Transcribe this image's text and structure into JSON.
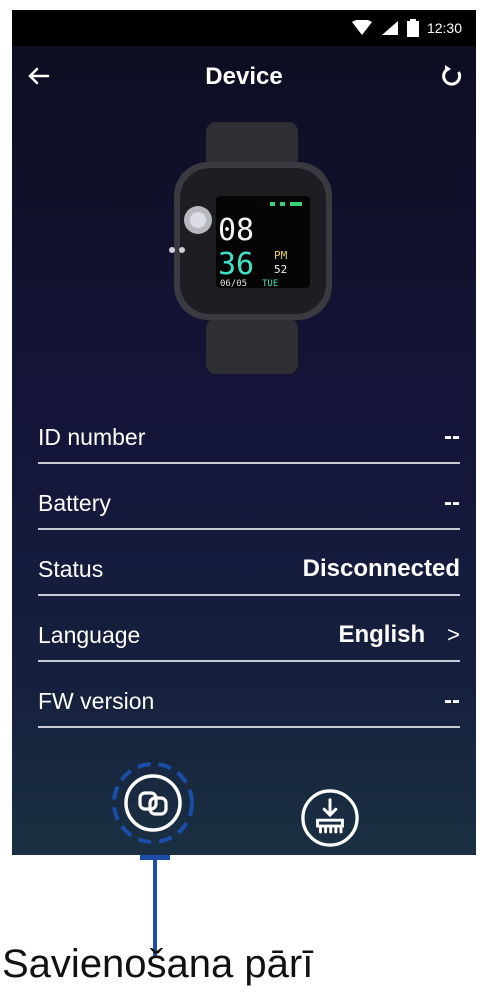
{
  "status_bar": {
    "time": "12:30"
  },
  "header": {
    "title": "Device"
  },
  "watch_face": {
    "hour": "08",
    "minute": "36",
    "ampm": "PM",
    "seconds": "52",
    "date": "06/05",
    "day": "TUE"
  },
  "rows": [
    {
      "label": "ID number",
      "value": "--"
    },
    {
      "label": "Battery",
      "value": "--"
    },
    {
      "label": "Status",
      "value": "Disconnected"
    },
    {
      "label": "Language",
      "value": "English",
      "chevron": ">"
    },
    {
      "label": "FW version",
      "value": "--"
    }
  ],
  "buttons": {
    "pair_icon": "link-icon",
    "update_icon": "download-icon"
  },
  "callout": {
    "text": "Savienošana pārī",
    "color": "#1a4ea8"
  }
}
